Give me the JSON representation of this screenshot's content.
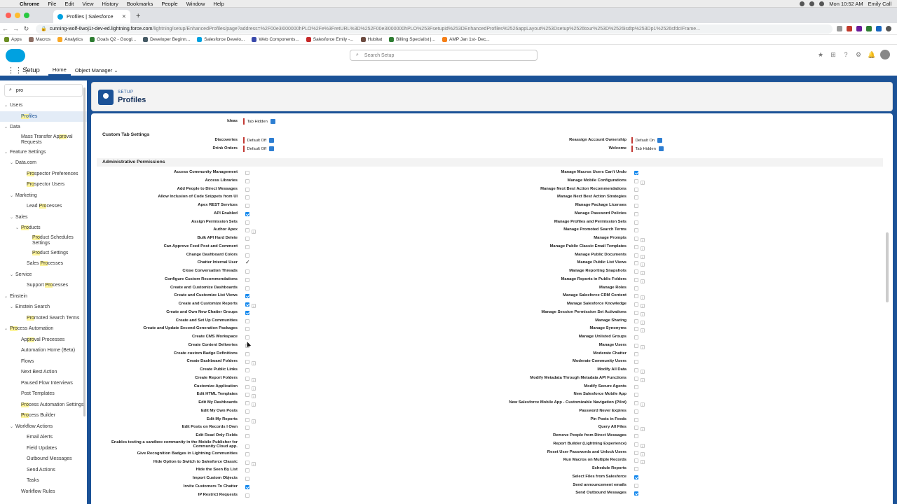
{
  "menubar": {
    "app": "Chrome",
    "items": [
      "File",
      "Edit",
      "View",
      "History",
      "Bookmarks",
      "People",
      "Window",
      "Help"
    ],
    "clock": "Mon 10:52 AM",
    "user": "Emily Call"
  },
  "tab": {
    "title": "Profiles | Salesforce",
    "close": "✕",
    "new": "+"
  },
  "address": {
    "host": "cunning-wolf-6woj1r-dev-ed.lightning.force.com",
    "path": "/lightning/setup/EnhancedProfiles/page?address=%2F00e3i000000hPLO%2Fe%3FretURL%3D%252F00e3i000000hPLO%253Fsetupid%253DEnhancedProfiles%2526appLayout%253Dsetup%2526tour%253D%2526isdtp%253Dp1%2526sfdcIFrame..."
  },
  "bookmarks": [
    "Apps",
    "Macros",
    "Analytics",
    "Goals Q2 - Googl...",
    "Developer Beginn...",
    "Salesforce Develo...",
    "Web Components...",
    "Salesforce Emily -...",
    "Hubitat",
    "Billing Specialist |...",
    "AMP Jan 1st- Dec..."
  ],
  "header": {
    "search_placeholder": "Search Setup"
  },
  "nav": {
    "app_name": "Setup",
    "tabs": [
      "Home",
      "Object Manager"
    ]
  },
  "sidebar": {
    "search_value": "pro",
    "items": [
      {
        "label": "Users",
        "level": 0,
        "caret": "v"
      },
      {
        "label": "Profiles",
        "level": 2,
        "selected": true,
        "hl": "Pro"
      },
      {
        "label": "Data",
        "level": 0,
        "caret": "v"
      },
      {
        "label": "Mass Transfer Approval Requests",
        "level": 2,
        "two": true,
        "hl": "pro"
      },
      {
        "label": "Feature Settings",
        "level": 0,
        "caret": "v"
      },
      {
        "label": "Data.com",
        "level": 1,
        "caret": "v"
      },
      {
        "label": "Prospector Preferences",
        "level": 3,
        "hl": "Pro"
      },
      {
        "label": "Prospector Users",
        "level": 3,
        "hl": "Pro"
      },
      {
        "label": "Marketing",
        "level": 1,
        "caret": "v"
      },
      {
        "label": "Lead Processes",
        "level": 3,
        "hl": "Pro"
      },
      {
        "label": "Sales",
        "level": 1,
        "caret": "v"
      },
      {
        "label": "Products",
        "level": 2,
        "caret": "v",
        "hl": "Pro"
      },
      {
        "label": "Product Schedules Settings",
        "level": 4,
        "two": true,
        "hl": "Pro"
      },
      {
        "label": "Product Settings",
        "level": 4,
        "hl": "Pro"
      },
      {
        "label": "Sales Processes",
        "level": 3,
        "hl": "Pro"
      },
      {
        "label": "Service",
        "level": 1,
        "caret": "v"
      },
      {
        "label": "Support Processes",
        "level": 3,
        "hl": "Pro"
      },
      {
        "label": "Einstein",
        "level": 0,
        "caret": "v"
      },
      {
        "label": "Einstein Search",
        "level": 1,
        "caret": "v"
      },
      {
        "label": "Promoted Search Terms",
        "level": 3,
        "hl": "Pro"
      },
      {
        "label": "Process Automation",
        "level": 0,
        "caret": "v",
        "hl": "Pro"
      },
      {
        "label": "Approval Processes",
        "level": 2,
        "hl": "pro"
      },
      {
        "label": "Automation Home (Beta)",
        "level": 2
      },
      {
        "label": "Flows",
        "level": 2
      },
      {
        "label": "Next Best Action",
        "level": 2
      },
      {
        "label": "Paused Flow Interviews",
        "level": 2
      },
      {
        "label": "Post Templates",
        "level": 2
      },
      {
        "label": "Process Automation Settings",
        "level": 2,
        "hl": "Pro"
      },
      {
        "label": "Process Builder",
        "level": 2,
        "hl": "Pro"
      },
      {
        "label": "Workflow Actions",
        "level": 1,
        "caret": "v"
      },
      {
        "label": "Email Alerts",
        "level": 3
      },
      {
        "label": "Field Updates",
        "level": 3
      },
      {
        "label": "Outbound Messages",
        "level": 3
      },
      {
        "label": "Send Actions",
        "level": 3
      },
      {
        "label": "Tasks",
        "level": 3
      },
      {
        "label": "Workflow Rules",
        "level": 2
      }
    ]
  },
  "page": {
    "kicker": "SETUP",
    "title": "Profiles"
  },
  "tab_settings": {
    "ideas_label": "Ideas",
    "ideas_value": "Tab Hidden",
    "section": "Custom Tab Settings",
    "left": [
      {
        "label": "Discoveries",
        "value": "Default Off"
      },
      {
        "label": "Drink Orders",
        "value": "Default Off"
      }
    ],
    "right": [
      {
        "label": "Reassign Account Ownership",
        "value": "Default On"
      },
      {
        "label": "Welcome",
        "value": "Tab Hidden"
      }
    ]
  },
  "admin": {
    "section": "Administrative Permissions",
    "left": [
      {
        "label": "Access Community Management",
        "state": "off"
      },
      {
        "label": "Access Libraries",
        "state": "off"
      },
      {
        "label": "Add People to Direct Messages",
        "state": "off"
      },
      {
        "label": "Allow Inclusion of Code Snippets from UI",
        "state": "off"
      },
      {
        "label": "Apex REST Services",
        "state": "off"
      },
      {
        "label": "API Enabled",
        "state": "on"
      },
      {
        "label": "Assign Permission Sets",
        "state": "off"
      },
      {
        "label": "Author Apex",
        "state": "off",
        "info": true
      },
      {
        "label": "Bulk API Hard Delete",
        "state": "off"
      },
      {
        "label": "Can Approve Feed Post and Comment",
        "state": "off"
      },
      {
        "label": "Change Dashboard Colors",
        "state": "off"
      },
      {
        "label": "Chatter Internal User",
        "state": "tick"
      },
      {
        "label": "Close Conversation Threads",
        "state": "off"
      },
      {
        "label": "Configure Custom Recommendations",
        "state": "off"
      },
      {
        "label": "Create and Customize Dashboards",
        "state": "off"
      },
      {
        "label": "Create and Customize List Views",
        "state": "on"
      },
      {
        "label": "Create and Customize Reports",
        "state": "on",
        "info": true
      },
      {
        "label": "Create and Own New Chatter Groups",
        "state": "on"
      },
      {
        "label": "Create and Set Up Communities",
        "state": "off"
      },
      {
        "label": "Create and Update Second-Generation Packages",
        "state": "off"
      },
      {
        "label": "Create CMS Workspace",
        "state": "off"
      },
      {
        "label": "Create Content Deliveries",
        "state": "off"
      },
      {
        "label": "Create custom Badge Definitions",
        "state": "off"
      },
      {
        "label": "Create Dashboard Folders",
        "state": "off",
        "info": true
      },
      {
        "label": "Create Public Links",
        "state": "off"
      },
      {
        "label": "Create Report Folders",
        "state": "off",
        "info": true
      },
      {
        "label": "Customize Application",
        "state": "off",
        "info": true
      },
      {
        "label": "Edit HTML Templates",
        "state": "off",
        "info": true
      },
      {
        "label": "Edit My Dashboards",
        "state": "off",
        "info": true
      },
      {
        "label": "Edit My Own Posts",
        "state": "off"
      },
      {
        "label": "Edit My Reports",
        "state": "off",
        "info": true
      },
      {
        "label": "Edit Posts on Records I Own",
        "state": "off"
      },
      {
        "label": "Edit Read Only Fields",
        "state": "off"
      },
      {
        "label": "Enables testing a sandbox community in the Mobile Publisher for Community Cloud app.",
        "state": "off",
        "two": true
      },
      {
        "label": "Give Recognition Badges in Lightning Communities",
        "state": "off"
      },
      {
        "label": "Hide Option to Switch to Salesforce Classic",
        "state": "off",
        "info": true
      },
      {
        "label": "Hide the Seen By List",
        "state": "off"
      },
      {
        "label": "Import Custom Objects",
        "state": "off"
      },
      {
        "label": "Invite Customers To Chatter",
        "state": "on"
      },
      {
        "label": "IP Restrict Requests",
        "state": "off"
      }
    ],
    "right": [
      {
        "label": "Manage Macros Users Can't Undo",
        "state": "on"
      },
      {
        "label": "Manage Mobile Configurations",
        "state": "off",
        "info": true
      },
      {
        "label": "Manage Next Best Action Recommendations",
        "state": "off"
      },
      {
        "label": "Manage Next Best Action Strategies",
        "state": "off"
      },
      {
        "label": "Manage Package Licenses",
        "state": "off"
      },
      {
        "label": "Manage Password Policies",
        "state": "off"
      },
      {
        "label": "Manage Profiles and Permission Sets",
        "state": "off"
      },
      {
        "label": "Manage Promoted Search Terms",
        "state": "off"
      },
      {
        "label": "Manage Prompts",
        "state": "off",
        "info": true
      },
      {
        "label": "Manage Public Classic Email Templates",
        "state": "off",
        "info": true
      },
      {
        "label": "Manage Public Documents",
        "state": "off",
        "info": true
      },
      {
        "label": "Manage Public List Views",
        "state": "off",
        "info": true
      },
      {
        "label": "Manage Reporting Snapshots",
        "state": "off",
        "info": true
      },
      {
        "label": "Manage Reports in Public Folders",
        "state": "off",
        "info": true
      },
      {
        "label": "Manage Roles",
        "state": "off"
      },
      {
        "label": "Manage Salesforce CRM Content",
        "state": "off",
        "info": true
      },
      {
        "label": "Manage Salesforce Knowledge",
        "state": "off",
        "info": true
      },
      {
        "label": "Manage Session Permission Set Activations",
        "state": "off",
        "info": true
      },
      {
        "label": "Manage Sharing",
        "state": "off",
        "info": true
      },
      {
        "label": "Manage Synonyms",
        "state": "off",
        "info": true
      },
      {
        "label": "Manage Unlisted Groups",
        "state": "off"
      },
      {
        "label": "Manage Users",
        "state": "off",
        "info": true
      },
      {
        "label": "Moderate Chatter",
        "state": "off"
      },
      {
        "label": "Moderate Community Users",
        "state": "off"
      },
      {
        "label": "Modify All Data",
        "state": "off",
        "info": true
      },
      {
        "label": "Modify Metadata Through Metadata API Functions",
        "state": "off",
        "info": true
      },
      {
        "label": "Modify Secure Agents",
        "state": "off"
      },
      {
        "label": "New Salesforce Mobile App",
        "state": "off"
      },
      {
        "label": "New Salesforce Mobile App - Customizable Navigation (Pilot)",
        "state": "off",
        "info": true
      },
      {
        "label": "Password Never Expires",
        "state": "off"
      },
      {
        "label": "Pin Posts in Feeds",
        "state": "off"
      },
      {
        "label": "Query All Files",
        "state": "off",
        "info": true
      },
      {
        "label": "Remove People from Direct Messages",
        "state": "off"
      },
      {
        "label": "Report Builder (Lightning Experience)",
        "state": "off",
        "info": true
      },
      {
        "label": "Reset User Passwords and Unlock Users",
        "state": "off",
        "info": true
      },
      {
        "label": "Run Macros on Multiple Records",
        "state": "off",
        "info": true
      },
      {
        "label": "Schedule Reports",
        "state": "off"
      },
      {
        "label": "Select Files from Salesforce",
        "state": "on"
      },
      {
        "label": "Send announcement emails",
        "state": "off"
      },
      {
        "label": "Send Outbound Messages",
        "state": "on"
      }
    ]
  }
}
